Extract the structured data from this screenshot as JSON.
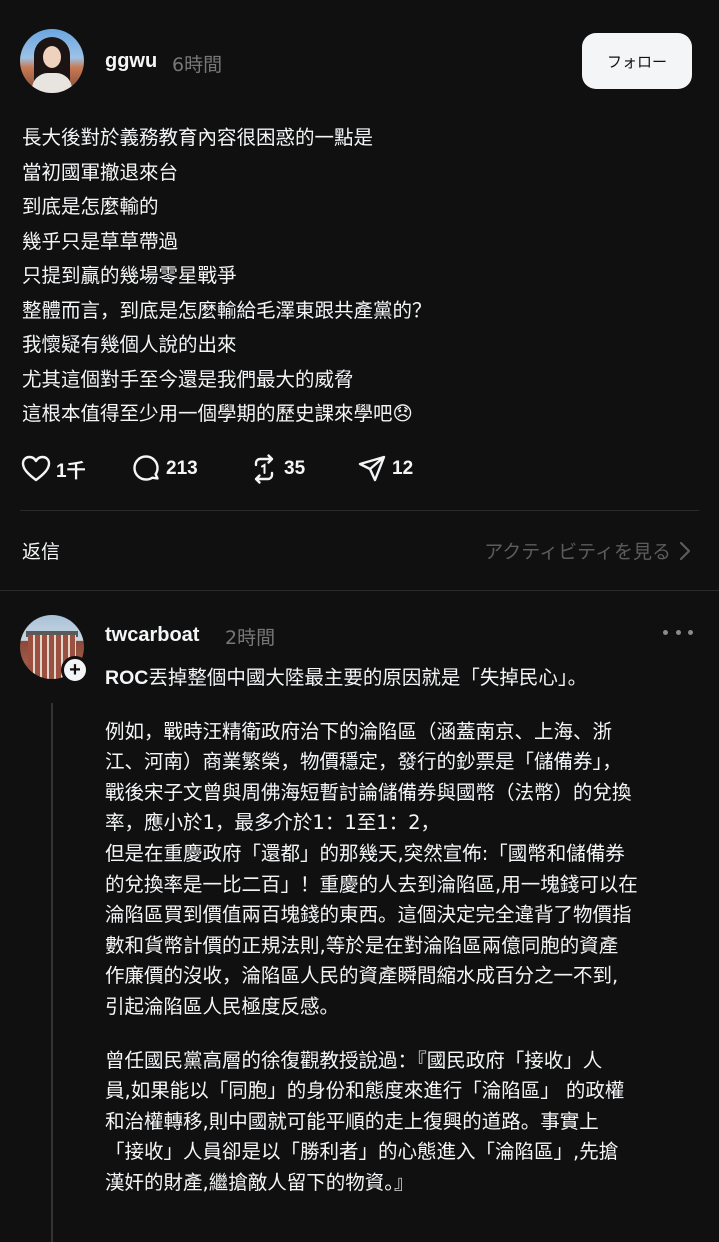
{
  "post": {
    "username": "ggwu",
    "time": "6時間",
    "follow_label": "フォロー",
    "lines": [
      "長大後對於義務教育內容很困惑的一點是",
      "當初國軍撤退來台",
      "到底是怎麼輸的",
      "幾乎只是草草帶過",
      "只提到贏的幾場零星戰爭",
      "整體而言，到底是怎麼輸給毛澤東跟共產黨的？",
      "我懷疑有幾個人說的出來",
      "尤其這個對手至今還是我們最大的威脅",
      "這根本值得至少用一個學期的歷史課來學吧😞"
    ],
    "likes": "1千",
    "comments": "213",
    "reposts": "35",
    "shares": "12"
  },
  "replies_bar": {
    "label": "返信",
    "activity_link": "アクティビティを見る"
  },
  "reply": {
    "username": "twcarboat",
    "time": "2時間",
    "p1": {
      "bold": "ROC",
      "rest": "丟掉整個中國大陸最主要的原因就是「失掉民心」。"
    },
    "p2": [
      "例如，戰時汪精衛政府治下的淪陷區（涵蓋南京、上海、浙",
      "江、河南）商業繁榮，物價穩定，發行的鈔票是「儲備券」，",
      "戰後宋子文曾與周佛海短暫討論儲備券與國幣（法幣）的兌換",
      "率，應小於1，最多介於1：1至1：2，",
      "但是在重慶政府「還都」的那幾天,突然宣佈:「國幣和儲備券",
      "的兌換率是一比二百」！重慶的人去到淪陷區,用一塊錢可以在",
      "淪陷區買到價值兩百塊錢的東西。這個決定完全違背了物價指",
      "數和貨幣計價的正規法則,等於是在對淪陷區兩億同胞的資產",
      "作廉價的沒收，淪陷區人民的資產瞬間縮水成百分之一不到,",
      "引起淪陷區人民極度反感。"
    ],
    "p3": [
      "曾任國民黨高層的徐復觀教授說過：『國民政府「接收」人",
      "員,如果能以「同胞」的身份和態度來進行「淪陷區」 的政權",
      "和治權轉移,則中國就可能平順的走上復興的道路。事實上",
      "「接收」人員卻是以「勝利者」的心態進入「淪陷區」,先搶",
      "漢奸的財產,繼搶敵人留下的物資。』"
    ]
  },
  "icons": {
    "like": "heart-icon",
    "comment": "comment-bubble-icon",
    "repost": "repost-icon",
    "share": "send-icon",
    "chevron": "chevron-right-icon",
    "more": "more-dots-icon",
    "follow_badge": "plus-icon"
  }
}
